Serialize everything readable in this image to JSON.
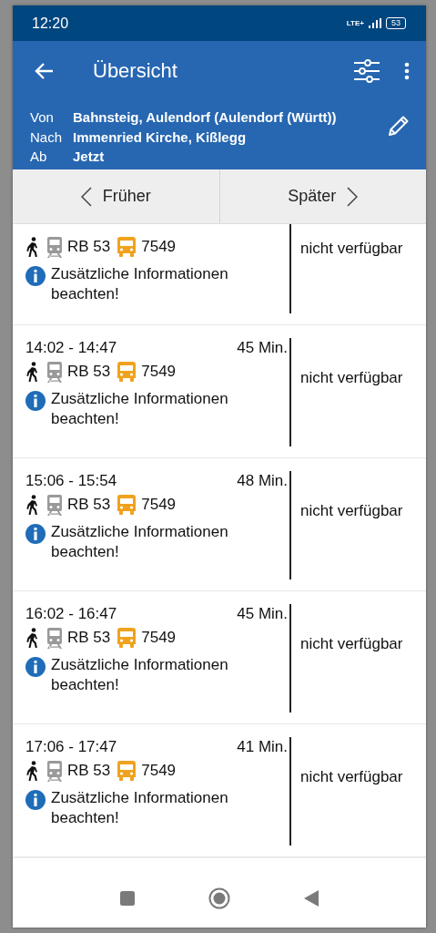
{
  "status_bar": {
    "time": "12:20",
    "network": "LTE+",
    "battery": "53"
  },
  "app_bar": {
    "title": "Übersicht"
  },
  "query": [
    {
      "label": "Von",
      "value": "Bahnsteig, Aulendorf (Aulendorf (Württ))"
    },
    {
      "label": "Nach",
      "value": "Immenried Kirche, Kißlegg"
    },
    {
      "label": "Ab",
      "value": "Jetzt"
    }
  ],
  "paging": {
    "earlier": "Früher",
    "later": "Später"
  },
  "connections": [
    {
      "legs": [
        {
          "kind": "walk"
        },
        {
          "kind": "train",
          "label": "RB 53"
        },
        {
          "kind": "bus",
          "label": "7549"
        }
      ],
      "note": "Zusätzliche Informationen beachten!",
      "availability": "nicht verfügbar"
    },
    {
      "time": "14:02 - 14:47",
      "duration": "45 Min.",
      "legs": [
        {
          "kind": "walk"
        },
        {
          "kind": "train",
          "label": "RB 53"
        },
        {
          "kind": "bus",
          "label": "7549"
        }
      ],
      "note": "Zusätzliche Informationen beachten!",
      "availability": "nicht verfügbar"
    },
    {
      "time": "15:06 - 15:54",
      "duration": "48 Min.",
      "legs": [
        {
          "kind": "walk"
        },
        {
          "kind": "train",
          "label": "RB 53"
        },
        {
          "kind": "bus",
          "label": "7549"
        }
      ],
      "note": "Zusätzliche Informationen beachten!",
      "availability": "nicht verfügbar"
    },
    {
      "time": "16:02 - 16:47",
      "duration": "45 Min.",
      "legs": [
        {
          "kind": "walk"
        },
        {
          "kind": "train",
          "label": "RB 53"
        },
        {
          "kind": "bus",
          "label": "7549"
        }
      ],
      "note": "Zusätzliche Informationen beachten!",
      "availability": "nicht verfügbar"
    },
    {
      "time": "17:06 - 17:47",
      "duration": "41 Min.",
      "legs": [
        {
          "kind": "walk"
        },
        {
          "kind": "train",
          "label": "RB 53"
        },
        {
          "kind": "bus",
          "label": "7549"
        }
      ],
      "note": "Zusätzliche Informationen beachten!",
      "availability": "nicht verfügbar"
    }
  ]
}
